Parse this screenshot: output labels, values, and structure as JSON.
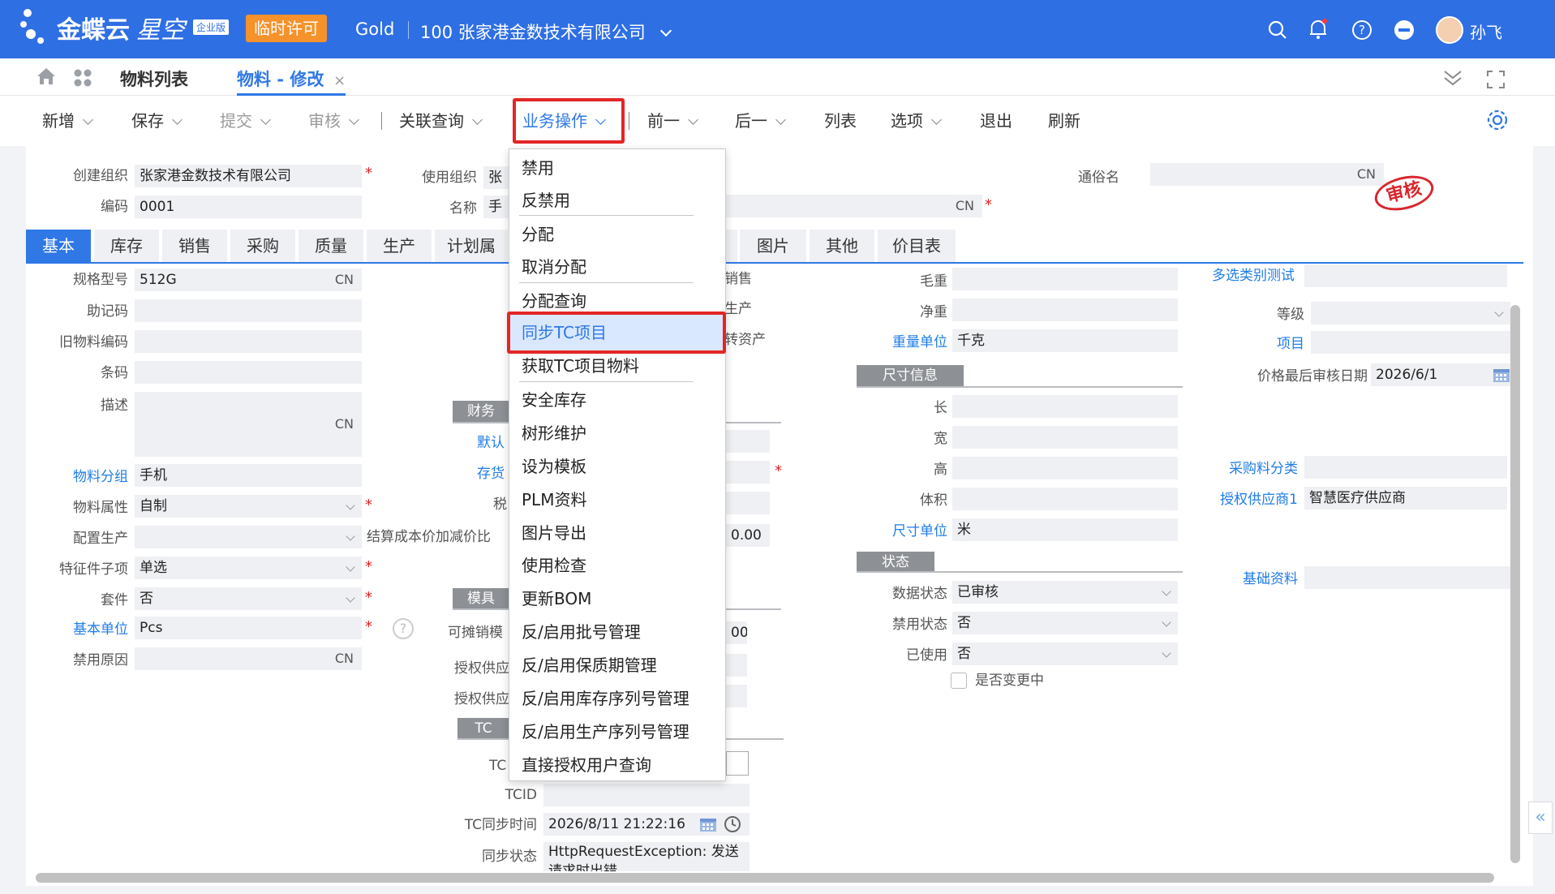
{
  "header": {
    "brand": "金蝶云",
    "product": "星空",
    "edition": "企业版",
    "license_badge": "临时许可",
    "tenant": "Gold",
    "company": "100 张家港金数技术有限公司",
    "user": "孙飞"
  },
  "tabs": {
    "list_tab": "物料列表",
    "edit_tab": "物料 - 修改"
  },
  "toolbar": {
    "new": "新增",
    "save": "保存",
    "submit": "提交",
    "audit": "审核",
    "related": "关联查询",
    "business": "业务操作",
    "prev": "前一",
    "next": "后一",
    "list": "列表",
    "options": "选项",
    "exit": "退出",
    "refresh": "刷新"
  },
  "menu": {
    "items": [
      "禁用",
      "反禁用",
      "分配",
      "取消分配",
      "分配查询",
      "同步TC项目",
      "获取TC项目物料",
      "安全库存",
      "树形维护",
      "设为模板",
      "PLM资料",
      "图片导出",
      "使用检查",
      "更新BOM",
      "反/启用批号管理",
      "反/启用保质期管理",
      "反/启用库存序列号管理",
      "反/启用生产序列号管理",
      "直接授权用户查询"
    ],
    "highlighted": "同步TC项目"
  },
  "head_form": {
    "create_org_label": "创建组织",
    "create_org": "张家港金数技术有限公司",
    "use_org_label": "使用组织",
    "use_org_partial": "张",
    "common_name_label": "通俗名",
    "cn": "CN",
    "code_label": "编码",
    "code": "0001",
    "name_label": "名称",
    "name_partial": "手",
    "stamp": "审核"
  },
  "subtabs": [
    "基本",
    "库存",
    "销售",
    "采购",
    "质量",
    "生产",
    "计划属",
    "图片",
    "其他",
    "价目表"
  ],
  "basic": {
    "spec_label": "规格型号",
    "spec": "512G",
    "mnemonic_label": "助记码",
    "old_code_label": "旧物料编码",
    "barcode_label": "条码",
    "desc_label": "描述",
    "group_label": "物料分组",
    "group": "手机",
    "attr_label": "物料属性",
    "attr": "自制",
    "config_label": "配置生产",
    "feature_label": "特征件子项",
    "feature": "单选",
    "kit_label": "套件",
    "kit": "否",
    "base_unit_label": "基本单位",
    "base_unit": "Pcs",
    "disable_reason_label": "禁用原因",
    "help_icon": "?"
  },
  "middle": {
    "sales_tail": "销售",
    "production_tail": "生产",
    "asset_tail": "转资产",
    "finance_partial": "财务",
    "default_partial": "默认",
    "inventory_partial": "存货",
    "tax_partial": "税",
    "settle_label": "结算成本价加减价比",
    "settle_value": "0.00",
    "module_partial": "模具",
    "sales_share_partial": "可摊销模",
    "share_value_partial": "00",
    "auth_sup1_partial": "授权供应",
    "auth_sup2_partial": "授权供应",
    "tc_section_partial": "TC",
    "tc_partial": "TC",
    "tcid_label": "TCID",
    "tc_sync_time_label": "TC同步时间",
    "tc_sync_time": "2026/8/11 21:22:16",
    "sync_status_label": "同步状态",
    "sync_status": "HttpRequestException: 发送请求时出错"
  },
  "right": {
    "gross_label": "毛重",
    "net_label": "净重",
    "weight_unit_label": "重量单位",
    "weight_unit": "千克",
    "size_section": "尺寸信息",
    "length_label": "长",
    "width_label": "宽",
    "height_label": "高",
    "volume_label": "体积",
    "size_unit_label": "尺寸单位",
    "size_unit": "米",
    "status_section": "状态",
    "data_status_label": "数据状态",
    "data_status": "已审核",
    "disable_status_label": "禁用状态",
    "disable_status": "否",
    "used_label": "已使用",
    "used": "否",
    "changing_label": "是否变更中"
  },
  "far_right": {
    "multi_label": "多选类别测试",
    "grade_label": "等级",
    "project_label": "项目",
    "price_date_label": "价格最后审核日期",
    "price_date": "2026/6/1",
    "purchase_cat_label": "采购料分类",
    "supplier_label": "授权供应商1",
    "supplier": "智慧医疗供应商",
    "basic_info_label": "基础资料"
  }
}
